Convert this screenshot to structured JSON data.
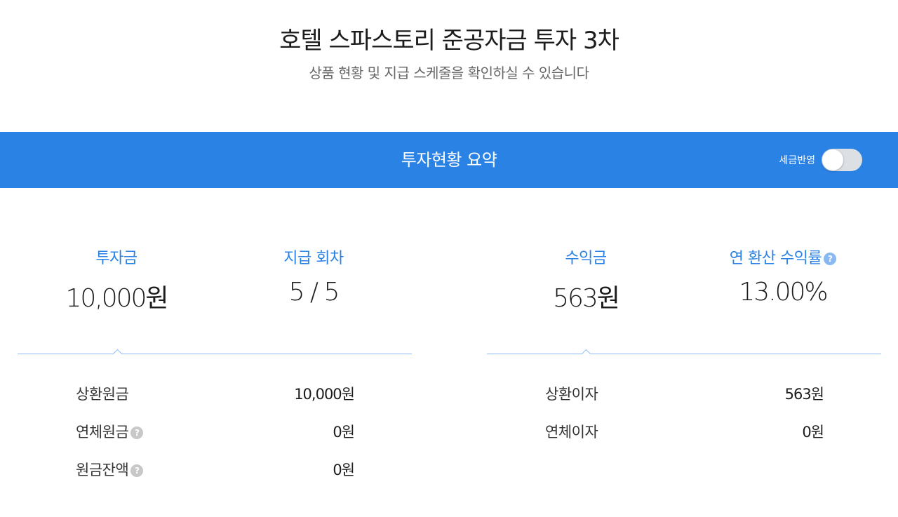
{
  "header": {
    "title": "호텔 스파스토리 준공자금 투자 3차",
    "subtitle": "상품 현황 및 지급 스케줄을 확인하실 수 있습니다"
  },
  "summary_bar": {
    "title": "투자현황 요약",
    "tax_toggle_label": "세금반영",
    "tax_toggle_on": false,
    "color": "#2a82e4"
  },
  "stats": {
    "investment": {
      "label": "투자금",
      "value": "10,000원"
    },
    "payment_round": {
      "label": "지급 회차",
      "value": "5 / 5"
    },
    "profit": {
      "label": "수익금",
      "value": "563원"
    },
    "annual_yield": {
      "label": "연 환산 수익률",
      "value": "13.00%",
      "help_icon": "question-circle-icon"
    }
  },
  "principal_details": {
    "repaid_principal": {
      "label": "상환원금",
      "value": "10,000원"
    },
    "overdue_principal": {
      "label": "연체원금",
      "value": "0원",
      "help_icon": "question-circle-icon"
    },
    "remaining_principal": {
      "label": "원금잔액",
      "value": "0원",
      "help_icon": "question-circle-icon"
    }
  },
  "interest_details": {
    "repaid_interest": {
      "label": "상환이자",
      "value": "563원"
    },
    "overdue_interest": {
      "label": "연체이자",
      "value": "0원"
    }
  },
  "help_glyph": "?"
}
